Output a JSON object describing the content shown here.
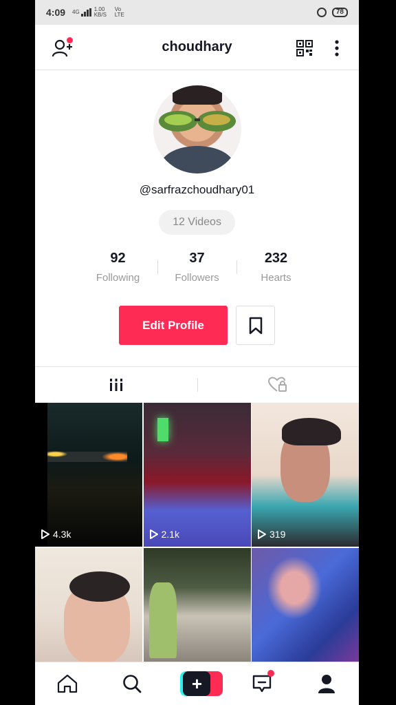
{
  "status_bar": {
    "time": "4:09",
    "network_speed": "1.00 KB/S",
    "network_top": "4G",
    "carrier": "Vo LTE",
    "battery": "78"
  },
  "header": {
    "title": "choudhary"
  },
  "profile": {
    "username": "@sarfrazchoudhary01",
    "videos_label": "12 Videos",
    "stats": [
      {
        "value": "92",
        "label": "Following"
      },
      {
        "value": "37",
        "label": "Followers"
      },
      {
        "value": "232",
        "label": "Hearts"
      }
    ],
    "edit_button": "Edit Profile"
  },
  "videos": [
    {
      "views": "4.3k"
    },
    {
      "views": "2.1k"
    },
    {
      "views": "319"
    }
  ],
  "colors": {
    "accent": "#fe2c55",
    "text": "#161823",
    "secondary_text": "#999999"
  },
  "icons": [
    "add-user-icon",
    "qr-code-icon",
    "more-vertical-icon",
    "bookmark-icon",
    "grid-icon",
    "liked-lock-icon",
    "play-icon",
    "home-icon",
    "search-icon",
    "plus-icon",
    "inbox-icon",
    "profile-icon"
  ]
}
